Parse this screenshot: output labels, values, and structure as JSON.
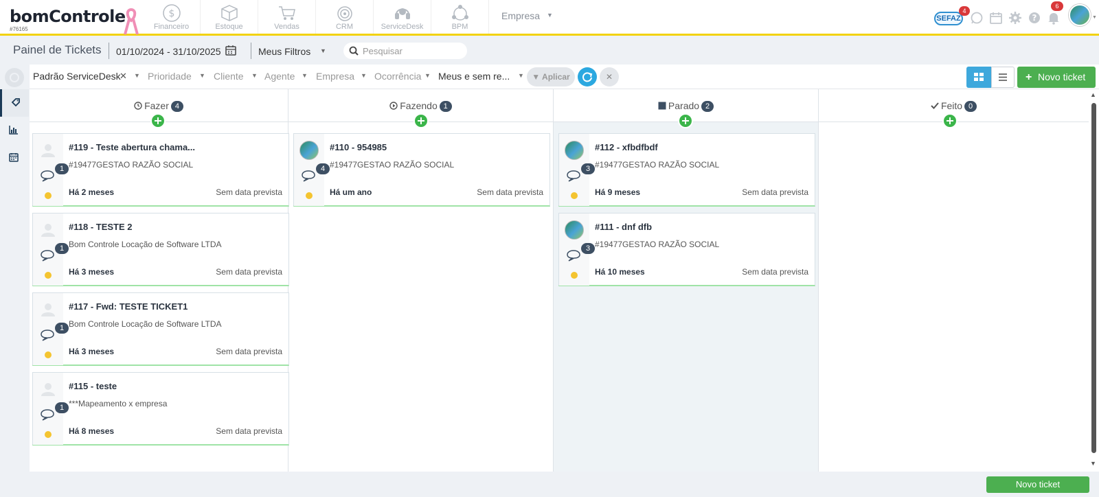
{
  "brand": {
    "name": "bomControle",
    "code": "#76165"
  },
  "modules": [
    {
      "label": "Financeiro",
      "icon": "dollar-circle-icon"
    },
    {
      "label": "Estoque",
      "icon": "box-icon"
    },
    {
      "label": "Vendas",
      "icon": "cart-icon"
    },
    {
      "label": "CRM",
      "icon": "target-icon"
    },
    {
      "label": "ServiceDesk",
      "icon": "headset-icon"
    },
    {
      "label": "BPM",
      "icon": "flow-icon"
    }
  ],
  "company_menu": "Empresa",
  "top_right": {
    "sefaz_label": "SEFAZ",
    "sefaz_count": "4",
    "notif_count": "6"
  },
  "header": {
    "title": "Painel de Tickets",
    "date_range": "01/10/2024 - 31/10/2025",
    "my_filters": "Meus Filtros",
    "search_placeholder": "Pesquisar"
  },
  "filters": {
    "preset": "Padrão ServiceDesk",
    "priority": "Prioridade",
    "client": "Cliente",
    "agent": "Agente",
    "company": "Empresa",
    "occurrence": "Ocorrência",
    "mine": "Meus e sem re...",
    "apply": "Aplicar"
  },
  "new_ticket": "Novo ticket",
  "columns": [
    {
      "title": "Fazer",
      "count": "4",
      "icon": "clock-icon",
      "cards": [
        {
          "title": "#119 - Teste abertura chama...",
          "sub": "#19477GESTAO RAZÃO SOCIAL",
          "comments": "1",
          "age": "Há 2 meses",
          "due": "Sem data prevista",
          "avatar": "blank"
        },
        {
          "title": "#118 - TESTE 2",
          "sub": "Bom Controle Locação de Software LTDA",
          "comments": "1",
          "age": "Há 3 meses",
          "due": "Sem data prevista",
          "avatar": "blank"
        },
        {
          "title": "#117 - Fwd: TESTE TICKET1",
          "sub": "Bom Controle Locação de Software LTDA",
          "comments": "1",
          "age": "Há 3 meses",
          "due": "Sem data prevista",
          "avatar": "blank"
        },
        {
          "title": "#115 - teste",
          "sub": "***Mapeamento x empresa",
          "comments": "1",
          "age": "Há 8 meses",
          "due": "Sem data prevista",
          "avatar": "blank"
        }
      ]
    },
    {
      "title": "Fazendo",
      "count": "1",
      "icon": "play-circle-icon",
      "cards": [
        {
          "title": "#110 - 954985",
          "sub": "#19477GESTAO RAZÃO SOCIAL",
          "comments": "4",
          "age": "Há um ano",
          "due": "Sem data prevista",
          "avatar": "photo"
        }
      ]
    },
    {
      "title": "Parado",
      "count": "2",
      "icon": "stop-square-icon",
      "cards": [
        {
          "title": "#112 - xfbdfbdf",
          "sub": "#19477GESTAO RAZÃO SOCIAL",
          "comments": "3",
          "age": "Há 9 meses",
          "due": "Sem data prevista",
          "avatar": "photo"
        },
        {
          "title": "#111 - dnf dfb",
          "sub": "#19477GESTAO RAZÃO SOCIAL",
          "comments": "3",
          "age": "Há 10 meses",
          "due": "Sem data prevista",
          "avatar": "photo"
        }
      ]
    },
    {
      "title": "Feito",
      "count": "0",
      "icon": "check-icon",
      "cards": []
    }
  ],
  "colors": {
    "accent_yellow": "#f2d20b",
    "primary_green": "#4caf50",
    "info_blue": "#3ea8dc",
    "badge_dark": "#3d4f63",
    "badge_red": "#d9383a"
  }
}
